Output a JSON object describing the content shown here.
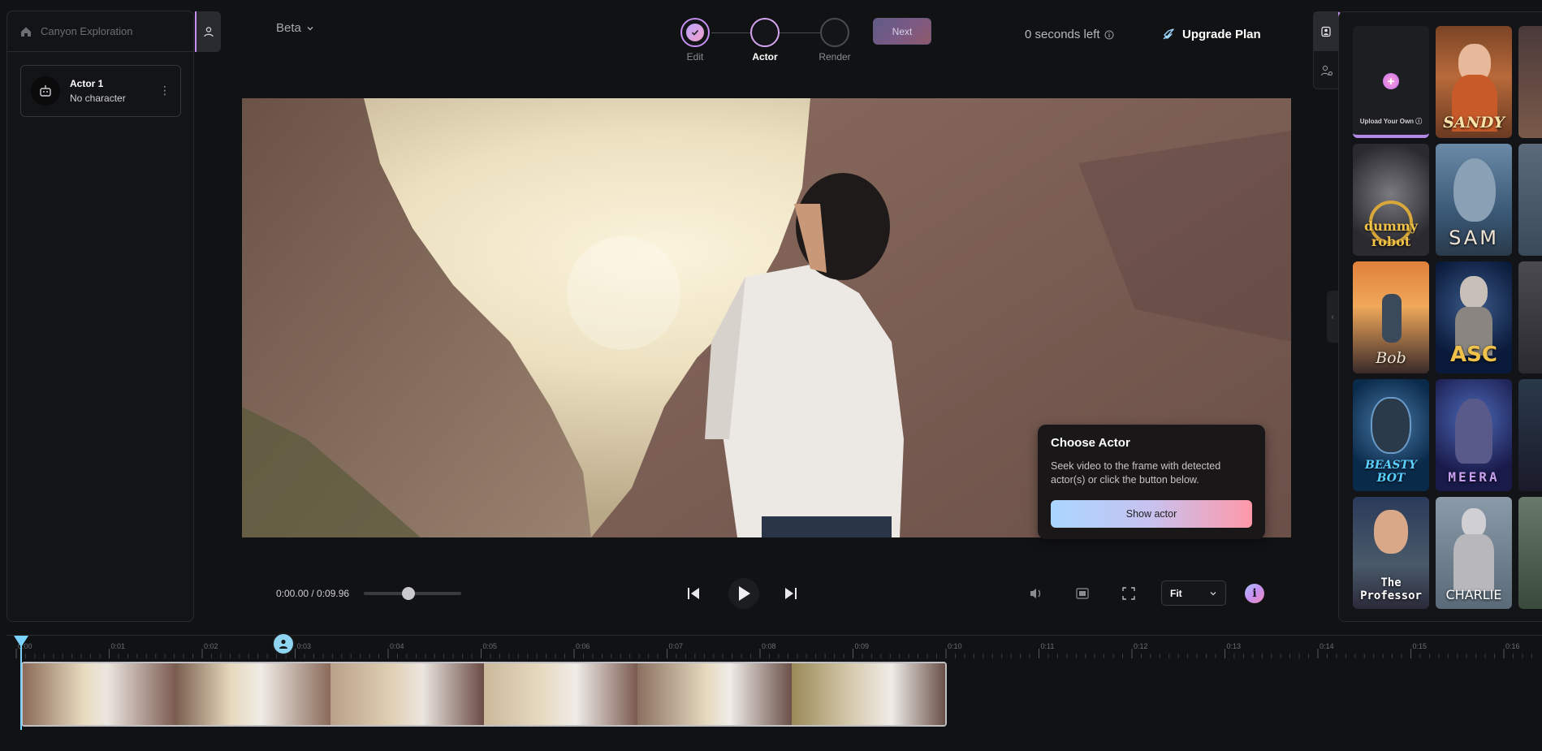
{
  "project": {
    "name": "Canyon Exploration"
  },
  "actors": [
    {
      "name": "Actor 1",
      "character": "No character"
    }
  ],
  "header": {
    "version": "Beta",
    "steps": [
      {
        "label": "Edit"
      },
      {
        "label": "Actor"
      },
      {
        "label": "Render"
      }
    ],
    "next_label": "Next",
    "seconds_left": "0 seconds left",
    "upgrade_label": "Upgrade Plan"
  },
  "library": {
    "upload_label": "Upload Your Own",
    "tiles": [
      {
        "label": "SANDY"
      },
      {
        "label": "dummy robot"
      },
      {
        "label": "SAM"
      },
      {
        "label": "Bob"
      },
      {
        "label": "ASC"
      },
      {
        "label": "BEASTY BOT"
      },
      {
        "label": "MEERA"
      },
      {
        "label": "The Professor"
      },
      {
        "label": "CHARLIE"
      }
    ]
  },
  "tooltip": {
    "title": "Choose Actor",
    "body": "Seek video to the frame with detected actor(s) or click the button below.",
    "button": "Show actor"
  },
  "player": {
    "timecode": "0:00.00 / 0:09.96",
    "scrub_fraction": 0.46,
    "zoom": "Fit"
  },
  "timeline": {
    "ticks": [
      "0:00",
      "0:01",
      "0:02",
      "0:03",
      "0:04",
      "0:05",
      "0:06",
      "0:07",
      "0:08",
      "0:09",
      "0:10",
      "0:11",
      "0:12",
      "0:13",
      "0:14",
      "0:15",
      "0:16"
    ]
  },
  "colors": {
    "accent": "#c38ff2",
    "playhead": "#7ad3ff"
  }
}
